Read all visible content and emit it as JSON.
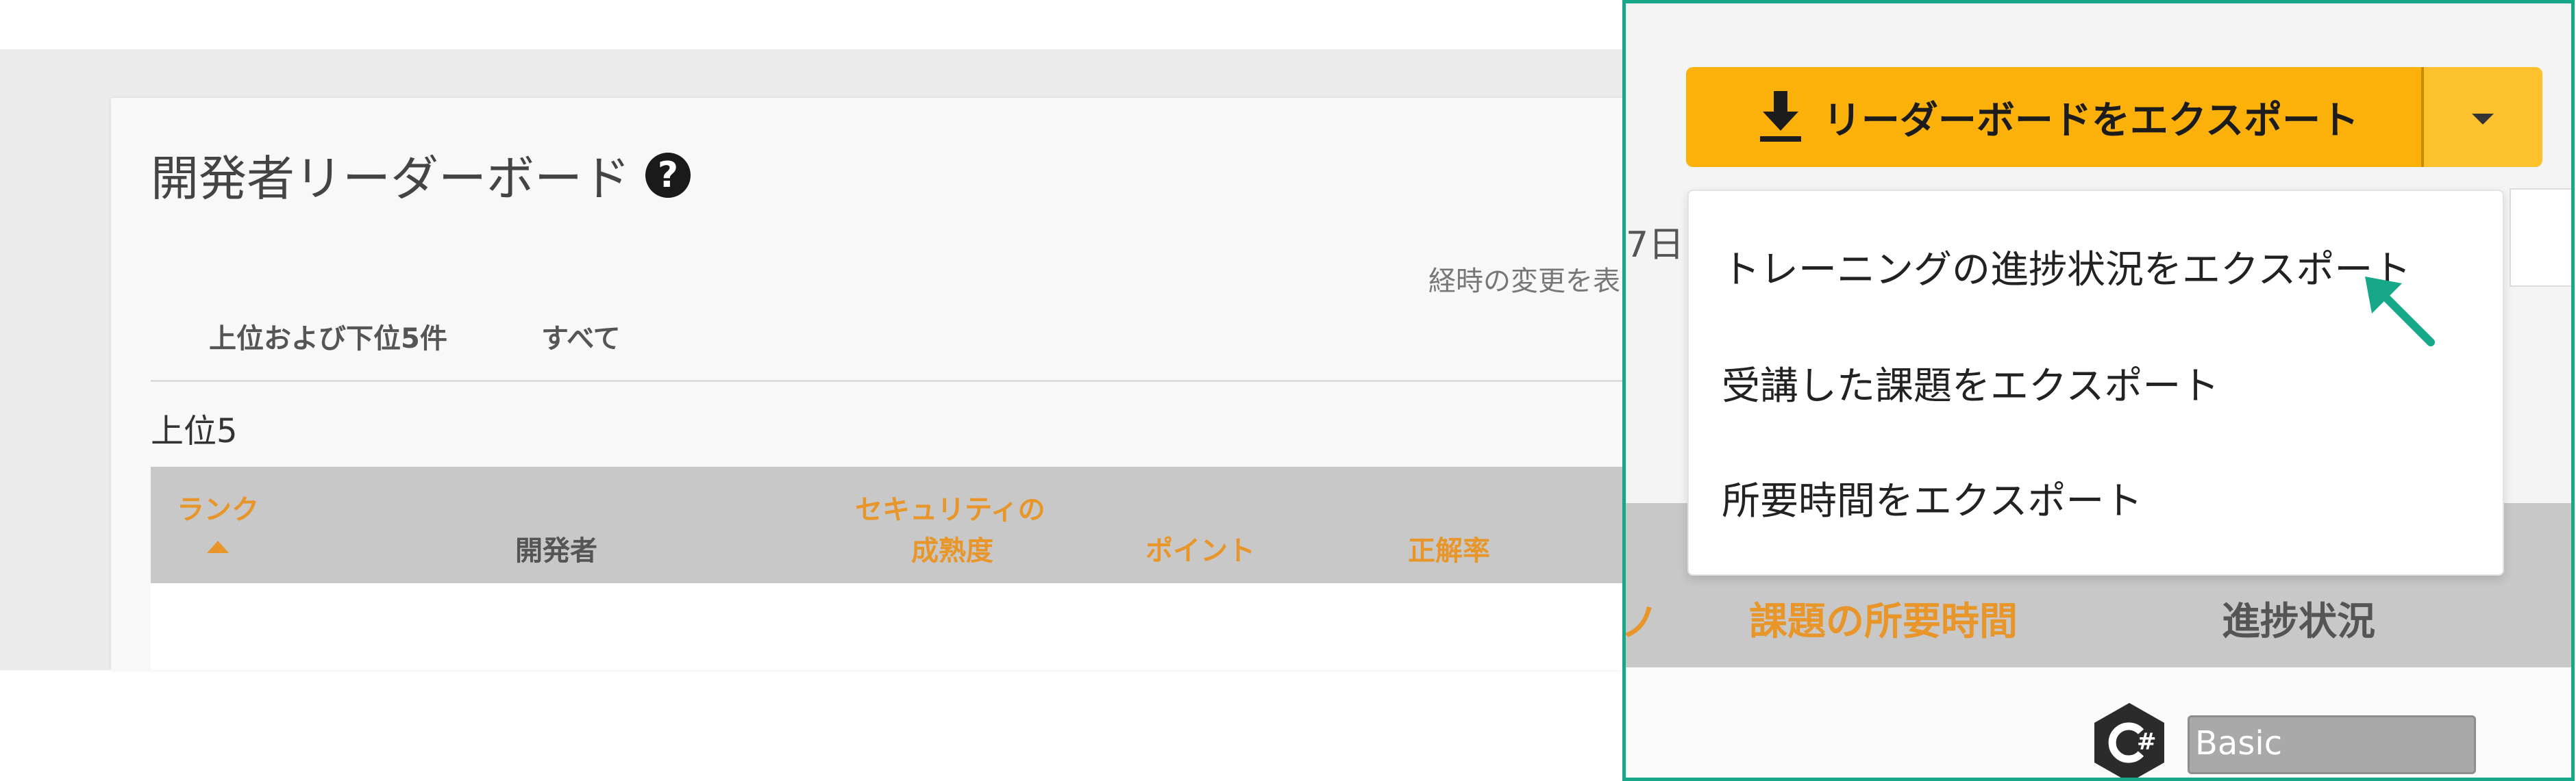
{
  "page": {
    "title": "開発者リーダーボード",
    "changes_text": "経時の変更を表",
    "tabs": [
      "上位および下位5件",
      "すべて"
    ],
    "section_label": "上位5"
  },
  "table": {
    "headers": {
      "rank": "ランク",
      "developer": "開発者",
      "security_line1": "セキュリティの",
      "security_line2": "成熟度",
      "points": "ポイント",
      "accuracy": "正解率",
      "challenge_time": "課題の所要時間",
      "progress": "進捗状況"
    },
    "header_fragment": "ノ"
  },
  "export": {
    "button_label": "リーダーボードをエクスポート",
    "menu_items": [
      "トレーニングの進捗状況をエクスポート",
      "受講した課題をエクスポート",
      "所要時間をエクスポート"
    ]
  },
  "filter": {
    "partial_text": "7日"
  },
  "row": {
    "language_icon": "csharp-icon",
    "level": "Basic"
  },
  "colors": {
    "accent_orange": "#e8962a",
    "export_yellow": "#fbb10a",
    "zoom_border": "#17a889",
    "cursor_arrow": "#17a889"
  },
  "icons": {
    "help": "question-circle-icon",
    "download": "download-icon",
    "caret": "caret-down-icon",
    "sort": "sort-up-icon",
    "cursor": "arrow-pointer-icon"
  }
}
